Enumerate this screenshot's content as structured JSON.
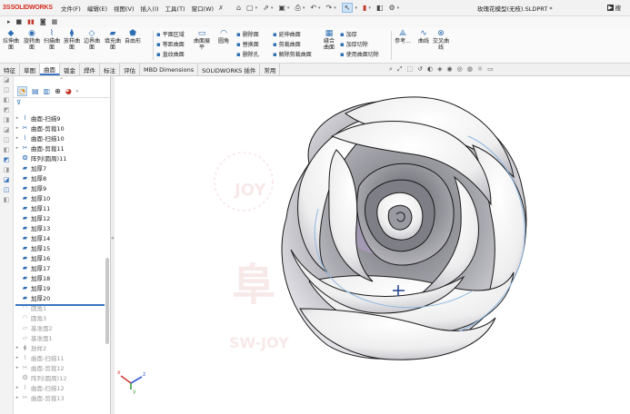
{
  "app": {
    "brand_prefix": "3S",
    "brand": "SOLIDWORKS",
    "document_title": "玫瑰花模型(无枝).SLDPRT *",
    "search_label": "搜"
  },
  "menu": [
    "文件(F)",
    "编辑(E)",
    "视图(V)",
    "插入(I)",
    "工具(T)",
    "窗口(W)"
  ],
  "ribbon": {
    "large_buttons": [
      {
        "label": "拉伸曲面",
        "icon": "extruded-surface-icon"
      },
      {
        "label": "旋转曲面",
        "icon": "revolved-surface-icon"
      },
      {
        "label": "扫描曲面",
        "icon": "swept-surface-icon"
      },
      {
        "label": "放样曲面",
        "icon": "lofted-surface-icon"
      },
      {
        "label": "边界曲面",
        "icon": "boundary-surface-icon"
      },
      {
        "label": "填充曲面",
        "icon": "filled-surface-icon"
      },
      {
        "label": "自由形",
        "icon": "freeform-icon"
      }
    ],
    "small_col1": [
      "平面区域",
      "等距曲面",
      "直纹曲面"
    ],
    "mid_buttons": [
      {
        "label": "曲面展平",
        "icon": "surface-flatten-icon"
      },
      {
        "label": "圆角",
        "icon": "fillet-icon"
      }
    ],
    "small_col2": [
      "删除面",
      "替换面",
      "删除孔"
    ],
    "small_col3": [
      "延伸曲面",
      "剪裁曲面",
      "解除剪裁曲面"
    ],
    "knit_button": "缝合曲面",
    "small_col4": [
      "加厚",
      "加厚切除",
      "使用曲面切除"
    ],
    "right_buttons": [
      {
        "label": "参考...",
        "icon": "reference-geometry-icon"
      },
      {
        "label": "曲线",
        "icon": "curves-icon"
      },
      {
        "label": "交叉曲线",
        "icon": "intersection-curve-icon"
      }
    ]
  },
  "tabs": [
    "特征",
    "草图",
    "曲面",
    "钣金",
    "焊件",
    "标注",
    "评估",
    "MBD Dimensions",
    "SOLIDWORKS 插件",
    "常用"
  ],
  "active_tab": "曲面",
  "tree": [
    {
      "label": "曲面-扫描9",
      "icon": "sweep",
      "arrow": true,
      "dim": false
    },
    {
      "label": "曲面-剪裁10",
      "icon": "trim",
      "arrow": true,
      "dim": false
    },
    {
      "label": "曲面-扫描10",
      "icon": "sweep",
      "arrow": true,
      "dim": false
    },
    {
      "label": "曲面-剪裁11",
      "icon": "trim",
      "arrow": true,
      "dim": false
    },
    {
      "label": "阵列(圆周)11",
      "icon": "pattern",
      "arrow": false,
      "dim": false
    },
    {
      "label": "加厚7",
      "icon": "thicken",
      "arrow": false,
      "dim": false
    },
    {
      "label": "加厚8",
      "icon": "thicken",
      "arrow": false,
      "dim": false
    },
    {
      "label": "加厚9",
      "icon": "thicken",
      "arrow": false,
      "dim": false
    },
    {
      "label": "加厚10",
      "icon": "thicken",
      "arrow": false,
      "dim": false
    },
    {
      "label": "加厚11",
      "icon": "thicken",
      "arrow": false,
      "dim": false
    },
    {
      "label": "加厚12",
      "icon": "thicken",
      "arrow": false,
      "dim": false
    },
    {
      "label": "加厚13",
      "icon": "thicken",
      "arrow": false,
      "dim": false
    },
    {
      "label": "加厚14",
      "icon": "thicken",
      "arrow": false,
      "dim": false
    },
    {
      "label": "加厚15",
      "icon": "thicken",
      "arrow": false,
      "dim": false
    },
    {
      "label": "加厚16",
      "icon": "thicken",
      "arrow": false,
      "dim": false
    },
    {
      "label": "加厚17",
      "icon": "thicken",
      "arrow": false,
      "dim": false
    },
    {
      "label": "加厚18",
      "icon": "thicken",
      "arrow": false,
      "dim": false
    },
    {
      "label": "加厚19",
      "icon": "thicken",
      "arrow": false,
      "dim": false
    },
    {
      "label": "加厚20",
      "icon": "thicken",
      "arrow": false,
      "dim": false
    },
    {
      "label": "圆角1",
      "icon": "fillet",
      "arrow": false,
      "dim": true
    },
    {
      "label": "圆角3",
      "icon": "fillet",
      "arrow": false,
      "dim": true
    },
    {
      "label": "基准面2",
      "icon": "plane",
      "arrow": false,
      "dim": true
    },
    {
      "label": "基准面1",
      "icon": "plane",
      "arrow": false,
      "dim": true
    },
    {
      "label": "放样2",
      "icon": "loft",
      "arrow": true,
      "dim": true
    },
    {
      "label": "曲面-扫描11",
      "icon": "sweep",
      "arrow": true,
      "dim": true
    },
    {
      "label": "曲面-剪裁12",
      "icon": "trim",
      "arrow": true,
      "dim": true
    },
    {
      "label": "阵列(圆周)12",
      "icon": "pattern",
      "arrow": false,
      "dim": true
    },
    {
      "label": "曲面-扫描12",
      "icon": "sweep",
      "arrow": true,
      "dim": true
    },
    {
      "label": "曲面-剪裁13",
      "icon": "trim",
      "arrow": true,
      "dim": true
    }
  ],
  "watermark": {
    "text_top": "JOY",
    "text_mid": "阜",
    "text_bottom": "SW-JOY"
  },
  "triad": {
    "x": "x",
    "y": "y",
    "z": "z"
  },
  "colors": {
    "accent": "#3a76c1",
    "brand": "#d52b1e",
    "rose_tint": "#c9a9e6"
  }
}
